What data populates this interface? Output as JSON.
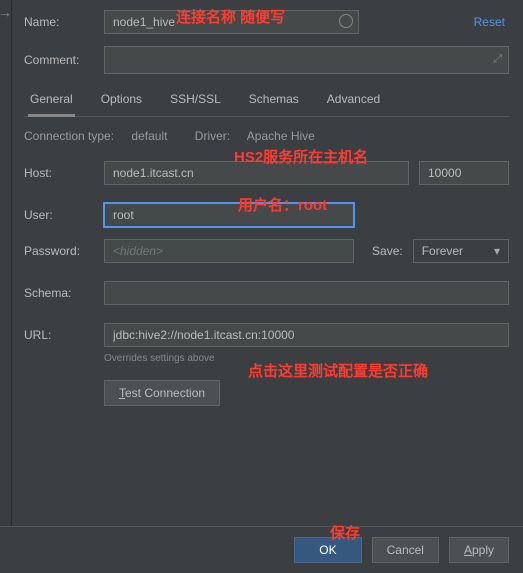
{
  "header": {
    "name_label": "Name:",
    "name_value": "node1_hive",
    "reset": "Reset",
    "comment_label": "Comment:"
  },
  "tabs": {
    "general": "General",
    "options": "Options",
    "ssh": "SSH/SSL",
    "schemas": "Schemas",
    "advanced": "Advanced"
  },
  "conn": {
    "type_label": "Connection type:",
    "type_value": "default",
    "driver_label": "Driver:",
    "driver_value": "Apache Hive"
  },
  "form": {
    "host_label": "Host:",
    "host_value": "node1.itcast.cn",
    "port_value": "10000",
    "user_label": "User:",
    "user_value": "root",
    "password_label": "Password:",
    "password_ph": "<hidden>",
    "save_label": "Save:",
    "save_value": "Forever",
    "schema_label": "Schema:",
    "schema_value": "",
    "url_label": "URL:",
    "url_value": "jdbc:hive2://node1.itcast.cn:10000",
    "url_hint": "Overrides settings above",
    "test_btn_pre": "T",
    "test_btn_rest": "est Connection"
  },
  "footer": {
    "ok": "OK",
    "cancel": "Cancel",
    "apply_pre": "A",
    "apply_rest": "pply"
  },
  "annotations": {
    "name": "连接名称 随便写",
    "host": "HS2服务所在主机名",
    "user": "用户名：root",
    "test": "点击这里测试配置是否正确",
    "save": "保存"
  }
}
